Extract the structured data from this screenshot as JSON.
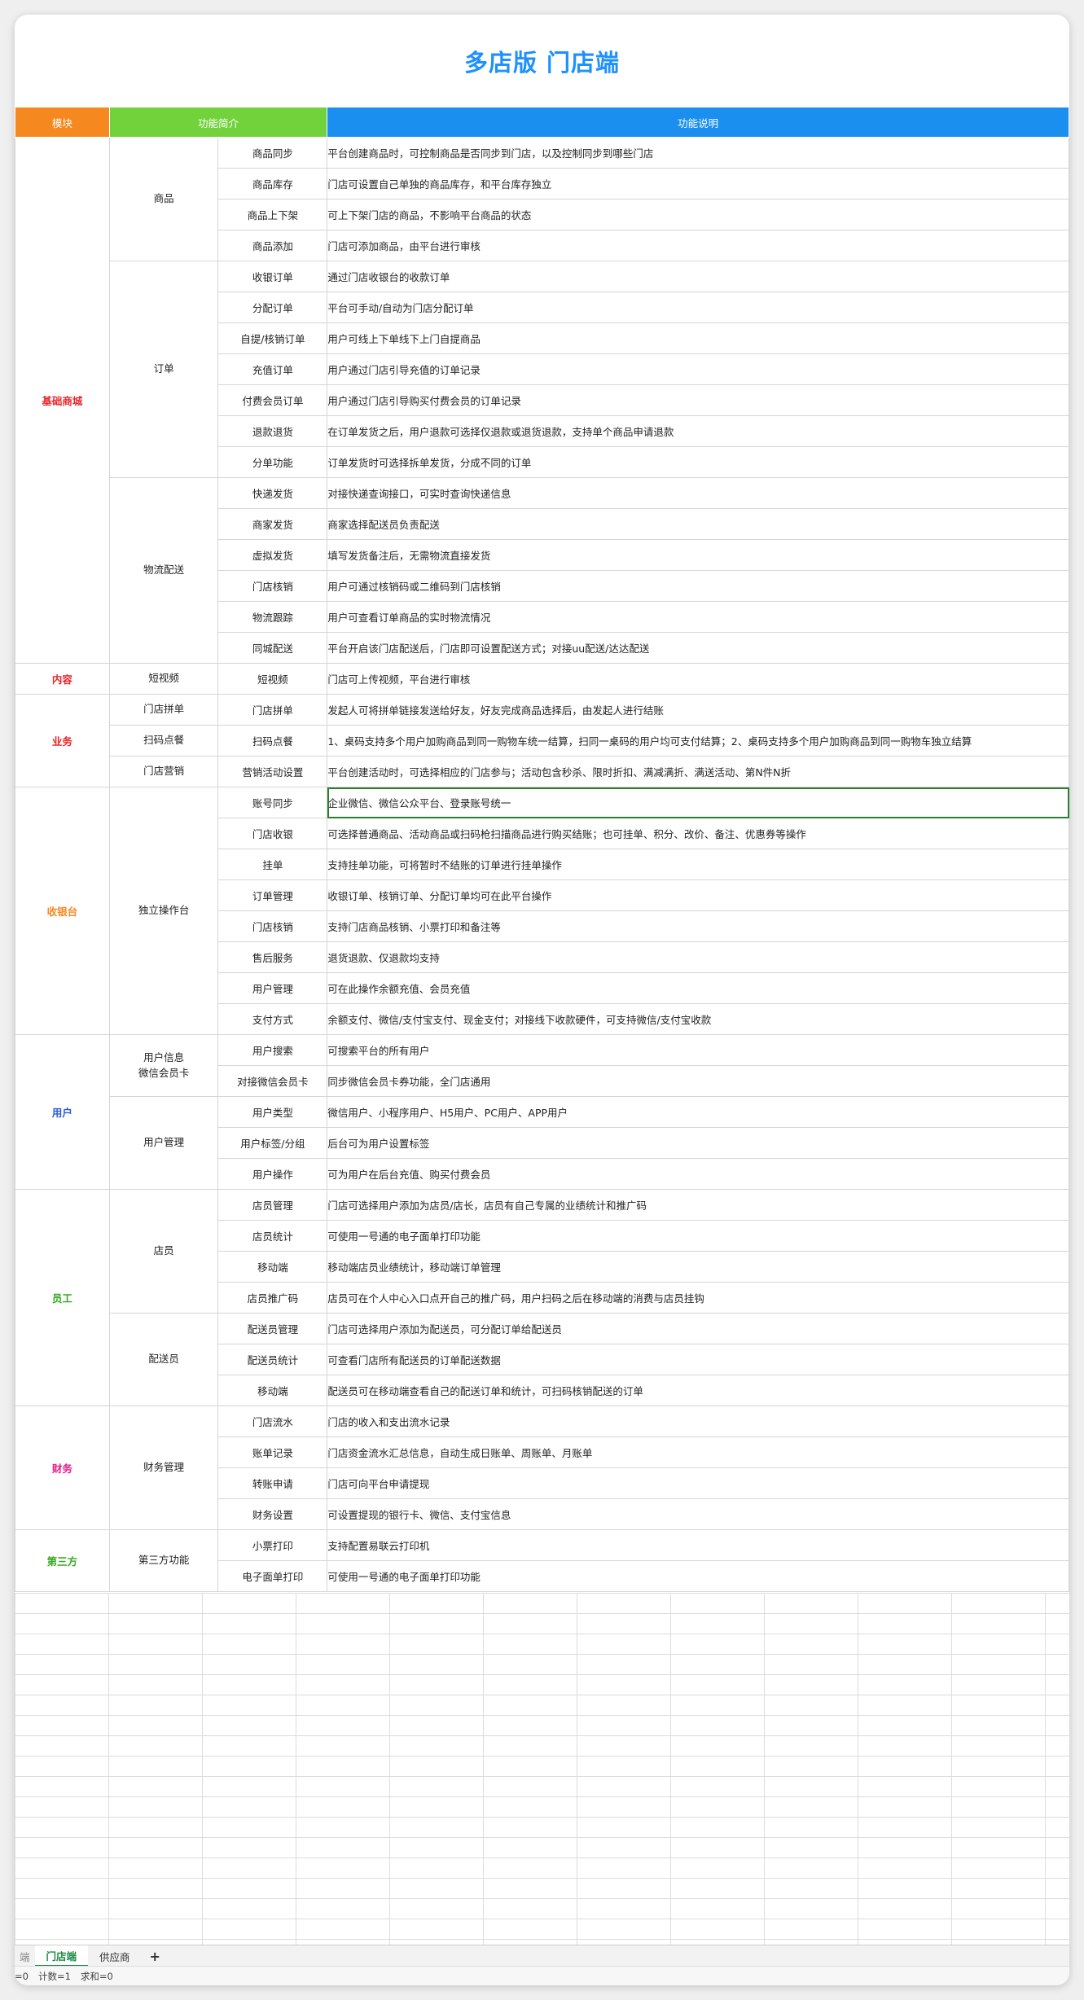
{
  "title": "多店版 门店端",
  "header": {
    "module": "模块",
    "intro": "功能简介",
    "desc": "功能说明"
  },
  "colors": {
    "module": "#f5881f",
    "intro": "#72d23b",
    "desc": "#1a8ff0",
    "title": "#1e90ff"
  },
  "rows": [
    {
      "feature": "商品同步",
      "desc": "平台创建商品时，可控制商品是否同步到门店，以及控制同步到哪些门店"
    },
    {
      "feature": "商品库存",
      "desc": "门店可设置自己单独的商品库存，和平台库存独立"
    },
    {
      "feature": "商品上下架",
      "desc": "可上下架门店的商品，不影响平台商品的状态"
    },
    {
      "feature": "商品添加",
      "desc": "门店可添加商品，由平台进行审核"
    },
    {
      "feature": "收银订单",
      "desc": "通过门店收银台的收款订单"
    },
    {
      "feature": "分配订单",
      "desc": "平台可手动/自动为门店分配订单"
    },
    {
      "feature": "自提/核销订单",
      "desc": "用户可线上下单线下上门自提商品"
    },
    {
      "feature": "充值订单",
      "desc": "用户通过门店引导充值的订单记录"
    },
    {
      "feature": "付费会员订单",
      "desc": "用户通过门店引导购买付费会员的订单记录"
    },
    {
      "feature": "退款退货",
      "desc": "在订单发货之后，用户退款可选择仅退款或退货退款，支持单个商品申请退款"
    },
    {
      "feature": "分单功能",
      "desc": "订单发货时可选择拆单发货，分成不同的订单"
    },
    {
      "feature": "快递发货",
      "desc": "对接快递查询接口，可实时查询快递信息"
    },
    {
      "feature": "商家发货",
      "desc": "商家选择配送员负责配送"
    },
    {
      "feature": "虚拟发货",
      "desc": "填写发货备注后，无需物流直接发货"
    },
    {
      "feature": "门店核销",
      "desc": "用户可通过核销码或二维码到门店核销"
    },
    {
      "feature": "物流跟踪",
      "desc": "用户可查看订单商品的实时物流情况"
    },
    {
      "feature": "同城配送",
      "desc": "平台开启该门店配送后，门店即可设置配送方式；对接uu配送/达达配送"
    },
    {
      "feature": "短视频",
      "desc": "门店可上传视频，平台进行审核"
    },
    {
      "feature": "门店拼单",
      "desc": "发起人可将拼单链接发送给好友，好友完成商品选择后，由发起人进行结账"
    },
    {
      "feature": "扫码点餐",
      "desc": "1、桌码支持多个用户加购商品到同一购物车统一结算，扫同一桌码的用户均可支付结算；2、桌码支持多个用户加购商品到同一购物车独立结算"
    },
    {
      "feature": "营销活动设置",
      "desc": "平台创建活动时，可选择相应的门店参与；活动包含秒杀、限时折扣、满减满折、满送活动、第N件N折"
    },
    {
      "feature": "账号同步",
      "desc": "企业微信、微信公众平台、登录账号统一"
    },
    {
      "feature": "门店收银",
      "desc": "可选择普通商品、活动商品或扫码枪扫描商品进行购买结账；也可挂单、积分、改价、备注、优惠券等操作"
    },
    {
      "feature": "挂单",
      "desc": "支持挂单功能，可将暂时不结账的订单进行挂单操作"
    },
    {
      "feature": "订单管理",
      "desc": "收银订单、核销订单、分配订单均可在此平台操作"
    },
    {
      "feature": "门店核销",
      "desc": "支持门店商品核销、小票打印和备注等"
    },
    {
      "feature": "售后服务",
      "desc": "退货退款、仅退款均支持"
    },
    {
      "feature": "用户管理",
      "desc": "可在此操作余额充值、会员充值"
    },
    {
      "feature": "支付方式",
      "desc": "余额支付、微信/支付宝支付、现金支付；对接线下收款硬件，可支持微信/支付宝收款"
    },
    {
      "feature": "用户搜索",
      "desc": "可搜索平台的所有用户"
    },
    {
      "feature": "对接微信会员卡",
      "desc": "同步微信会员卡券功能，全门店通用"
    },
    {
      "feature": "用户类型",
      "desc": "微信用户、小程序用户、H5用户、PC用户、APP用户"
    },
    {
      "feature": "用户标签/分组",
      "desc": "后台可为用户设置标签"
    },
    {
      "feature": "用户操作",
      "desc": "可为用户在后台充值、购买付费会员"
    },
    {
      "feature": "店员管理",
      "desc": "门店可选择用户添加为店员/店长，店员有自己专属的业绩统计和推广码"
    },
    {
      "feature": "店员统计",
      "desc": "可使用一号通的电子面单打印功能"
    },
    {
      "feature": "移动端",
      "desc": "移动端店员业绩统计，移动端订单管理"
    },
    {
      "feature": "店员推广码",
      "desc": "店员可在个人中心入口点开自己的推广码，用户扫码之后在移动端的消费与店员挂钩"
    },
    {
      "feature": "配送员管理",
      "desc": "门店可选择用户添加为配送员，可分配订单给配送员"
    },
    {
      "feature": "配送员统计",
      "desc": "可查看门店所有配送员的订单配送数据"
    },
    {
      "feature": "移动端",
      "desc": "配送员可在移动端查看自己的配送订单和统计，可扫码核销配送的订单"
    },
    {
      "feature": "门店流水",
      "desc": "门店的收入和支出流水记录"
    },
    {
      "feature": "账单记录",
      "desc": "门店资金流水汇总信息，自动生成日账单、周账单、月账单"
    },
    {
      "feature": "转账申请",
      "desc": "门店可向平台申请提现"
    },
    {
      "feature": "财务设置",
      "desc": "可设置提现的银行卡、微信、支付宝信息"
    },
    {
      "feature": "小票打印",
      "desc": "支持配置易联云打印机"
    },
    {
      "feature": "电子面单打印",
      "desc": "可使用一号通的电子面单打印功能"
    }
  ],
  "modules": [
    {
      "label": "基础商城",
      "color": "#e8262a",
      "start": 0,
      "span": 17
    },
    {
      "label": "内容",
      "color": "#e8262a",
      "start": 17,
      "span": 1
    },
    {
      "label": "业务",
      "color": "#e8262a",
      "start": 18,
      "span": 3
    },
    {
      "label": "收银台",
      "color": "#f5881f",
      "start": 21,
      "span": 8
    },
    {
      "label": "用户",
      "color": "#2a5bd7",
      "start": 29,
      "span": 5
    },
    {
      "label": "员工",
      "color": "#39a820",
      "start": 34,
      "span": 7
    },
    {
      "label": "财务",
      "color": "#e0208a",
      "start": 41,
      "span": 4
    },
    {
      "label": "第三方",
      "color": "#39a820",
      "start": 45,
      "span": 2
    }
  ],
  "groups": [
    {
      "label": "商品",
      "start": 0,
      "span": 4
    },
    {
      "label": "订单",
      "start": 4,
      "span": 7
    },
    {
      "label": "物流配送",
      "start": 11,
      "span": 6
    },
    {
      "label": "短视频",
      "start": 17,
      "span": 1
    },
    {
      "label": "门店拼单",
      "start": 18,
      "span": 1
    },
    {
      "label": "扫码点餐",
      "start": 19,
      "span": 1
    },
    {
      "label": "门店营销",
      "start": 20,
      "span": 1
    },
    {
      "label": "独立操作台",
      "start": 21,
      "span": 8
    },
    {
      "label": "用户信息\n微信会员卡",
      "start": 29,
      "span": 2
    },
    {
      "label": "用户管理",
      "start": 31,
      "span": 3
    },
    {
      "label": "店员",
      "start": 34,
      "span": 4
    },
    {
      "label": "配送员",
      "start": 38,
      "span": 3
    },
    {
      "label": "财务管理",
      "start": 41,
      "span": 4
    },
    {
      "label": "第三方功能",
      "start": 45,
      "span": 2
    }
  ],
  "tabs": [
    {
      "label": "端",
      "type": "edge"
    },
    {
      "label": "门店端",
      "type": "active"
    },
    {
      "label": "供应商",
      "type": "normal"
    },
    {
      "label": "+",
      "type": "add"
    }
  ],
  "status": [
    "=0",
    "计数=1",
    "求和=0"
  ]
}
